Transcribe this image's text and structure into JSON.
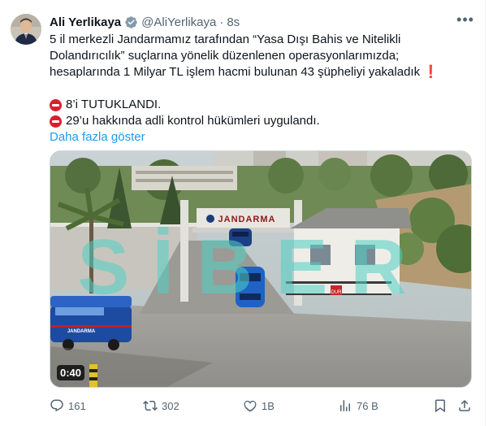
{
  "tweet": {
    "author_name": "Ali Yerlikaya",
    "handle": "@AliYerlikaya",
    "separator": "·",
    "time": "8s",
    "text_line1": "5 il merkezli Jandarmamız tarafından “Yasa Dışı Bahis ve Nitelikli Dolandırıcılık” suçlarına yönelik düzenlenen operasyonlarımızda; hesaplarında 1 Milyar TL işlem hacmi bulunan 43 şüpheliyi yakaladık",
    "exclamation": "❗",
    "arrested": "8’i TUTUKLANDI.",
    "judicial": "29’u hakkında adli kontrol hükümleri uygulandı.",
    "show_more": "Daha fazla göster",
    "more_icon": "•••"
  },
  "video": {
    "duration": "0:40",
    "sign_text": "JANDARMA",
    "van_text": "JANDARMA",
    "watermark": "SİBER",
    "stop_text": "DUR"
  },
  "actions": {
    "replies": "161",
    "reposts": "302",
    "likes": "1B",
    "views": "76 B"
  },
  "colors": {
    "accent": "#1d9bf0",
    "muted": "#536471",
    "noentry": "#d7202e"
  }
}
